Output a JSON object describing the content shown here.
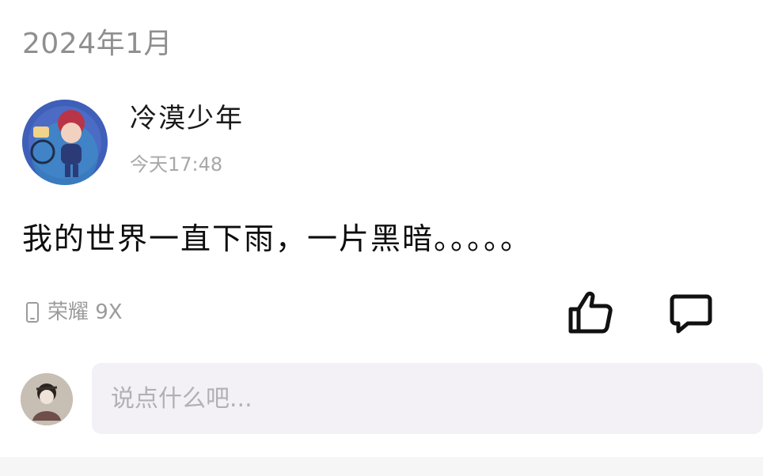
{
  "post": {
    "month_header": "2024年1月",
    "author": {
      "name": "冷漠少年",
      "avatar_icon": "cartoon-boy-avatar"
    },
    "time": "今天17:48",
    "content": "我的世界一直下雨，一片黑暗。。。。。",
    "device": {
      "icon": "phone-icon",
      "label": "荣耀 9X"
    },
    "actions": {
      "like_icon": "thumbs-up-icon",
      "comment_icon": "comment-icon"
    }
  },
  "comment_box": {
    "placeholder": "说点什么吧...",
    "value": "",
    "avatar_icon": "user-avatar"
  },
  "colors": {
    "background": "#ffffff",
    "input_background": "#f3f1f5",
    "secondary_text": "#9b9b9b"
  }
}
